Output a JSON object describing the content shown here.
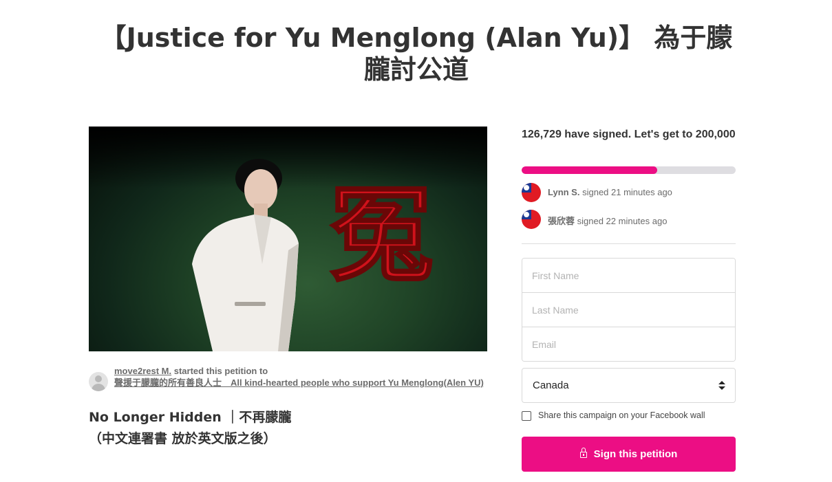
{
  "title": "【Justice for Yu Menglong (Alan Yu)】 為于朦朧討公道",
  "hero": {
    "overlay_character": "冤"
  },
  "starter": {
    "name": "move2rest M.",
    "action": "started this petition to",
    "target": "聲援于朦朧的所有善良人士　All kind-hearted people who support Yu Menglong(Alen YU)"
  },
  "petition": {
    "heading_line1": "No Longer Hidden ｜不再朦朧",
    "heading_line2": "（中文連署書 放於英文版之後）"
  },
  "signatures": {
    "count_text": "126,729 have signed. Let's get to 200,000",
    "signed": 126729,
    "goal": 200000,
    "progress_fraction": 0.6336
  },
  "recent_signers": [
    {
      "name": "Lynn S.",
      "text": "signed 21 minutes ago",
      "flag": "taiwan-flag-icon"
    },
    {
      "name": "張欣蓉",
      "text": "signed 22 minutes ago",
      "flag": "taiwan-flag-icon"
    }
  ],
  "form": {
    "first_name_placeholder": "First Name",
    "last_name_placeholder": "Last Name",
    "email_placeholder": "Email",
    "country_value": "Canada",
    "facebook_share_label": "Share this campaign on your Facebook wall",
    "sign_button_label": "Sign this petition"
  },
  "colors": {
    "accent": "#ec0e84",
    "progress_track": "#dedde1",
    "text": "#333333"
  }
}
